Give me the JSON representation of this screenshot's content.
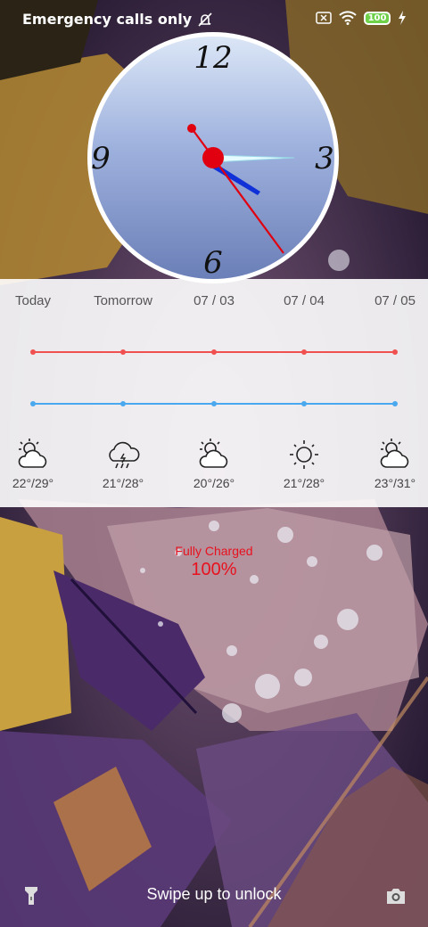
{
  "status_bar": {
    "carrier_text": "Emergency calls only",
    "battery_level": "100",
    "icons": [
      "alarm-off-icon",
      "sim-none-icon",
      "wifi-icon",
      "battery-icon",
      "charging-bolt-icon"
    ]
  },
  "clock": {
    "numerals": [
      "12",
      "3",
      "6",
      "9"
    ],
    "time": "2:21:25"
  },
  "weather": {
    "days": [
      {
        "label": "Today",
        "temps": "22°/29°",
        "icon": "sun-cloud-icon"
      },
      {
        "label": "Tomorrow",
        "temps": "21°/28°",
        "icon": "rain-cloud-icon"
      },
      {
        "label": "07 / 03",
        "temps": "20°/26°",
        "icon": "sun-cloud-icon"
      },
      {
        "label": "07 / 04",
        "temps": "21°/28°",
        "icon": "sun-icon"
      },
      {
        "label": "07 / 05",
        "temps": "23°/31°",
        "icon": "sun-cloud-icon"
      }
    ],
    "high_line_color": "#f05050",
    "low_line_color": "#4aa8ee"
  },
  "charging": {
    "title": "Fully Charged",
    "percent": "100%",
    "color": "#e8111e"
  },
  "bottom": {
    "hint": "Swipe up to unlock",
    "left_icon": "flashlight-icon",
    "right_icon": "camera-icon"
  }
}
